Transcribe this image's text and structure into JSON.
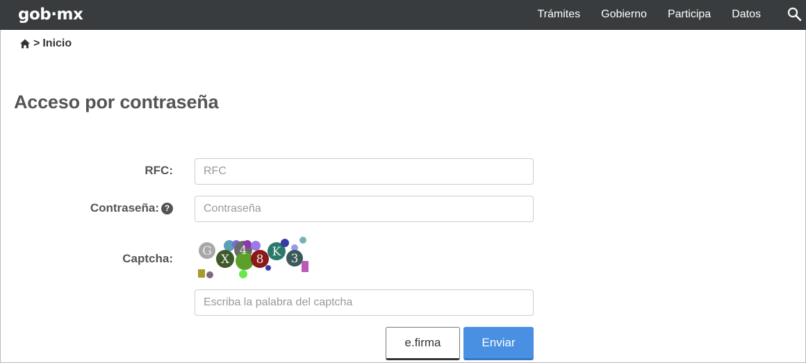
{
  "navbar": {
    "brand": "gob",
    "brand_suffix": "mx",
    "links": [
      "Trámites",
      "Gobierno",
      "Participa",
      "Datos"
    ],
    "search_icon": "search-icon"
  },
  "breadcrumb": {
    "home_icon": "home-icon",
    "separator": ">",
    "current": "Inicio"
  },
  "page": {
    "title": "Acceso por contraseña"
  },
  "form": {
    "rfc": {
      "label": "RFC:",
      "placeholder": "RFC",
      "value": ""
    },
    "password": {
      "label": "Contraseña:",
      "help_icon": "question-circle-icon",
      "help_glyph": "?",
      "placeholder": "Contraseña",
      "value": ""
    },
    "captcha": {
      "label": "Captcha:",
      "placeholder": "Escriba la palabra del captcha",
      "value": "",
      "characters": [
        "G",
        "X",
        "4",
        "8",
        "K",
        "3"
      ]
    }
  },
  "buttons": {
    "efirma": "e.firma",
    "enviar": "Enviar"
  },
  "colors": {
    "navbar_bg": "#393c3e",
    "primary_button": "#4a90e2",
    "label_text": "#545454"
  }
}
